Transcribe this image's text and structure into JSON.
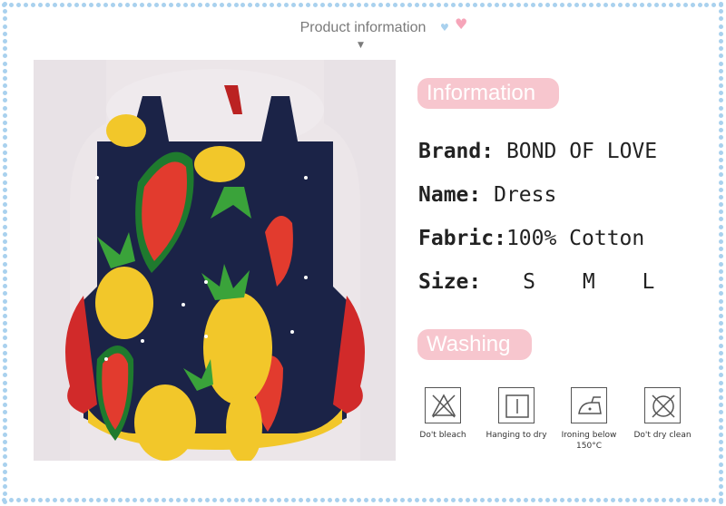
{
  "header": {
    "title": "Product information"
  },
  "colors": {
    "accent_pink": "#f7c6ce",
    "border_blue": "#a9d1ee",
    "text": "#222222"
  },
  "sections": {
    "information": "Information",
    "washing": "Washing"
  },
  "specs": {
    "brand_label": "Brand:",
    "brand_value": "BOND OF LOVE",
    "name_label": "Name:",
    "name_value": "Dress",
    "fabric_label": "Fabric:",
    "fabric_value": "100% Cotton",
    "size_label": "Size:",
    "sizes": [
      "S",
      "M",
      "L"
    ]
  },
  "care": [
    {
      "icon": "no-bleach-icon",
      "label": "Do't bleach"
    },
    {
      "icon": "hang-dry-icon",
      "label": "Hanging to dry"
    },
    {
      "icon": "iron-icon",
      "label": "Ironing below 150°C"
    },
    {
      "icon": "no-dry-clean-icon",
      "label": "Do't dry clean"
    }
  ]
}
